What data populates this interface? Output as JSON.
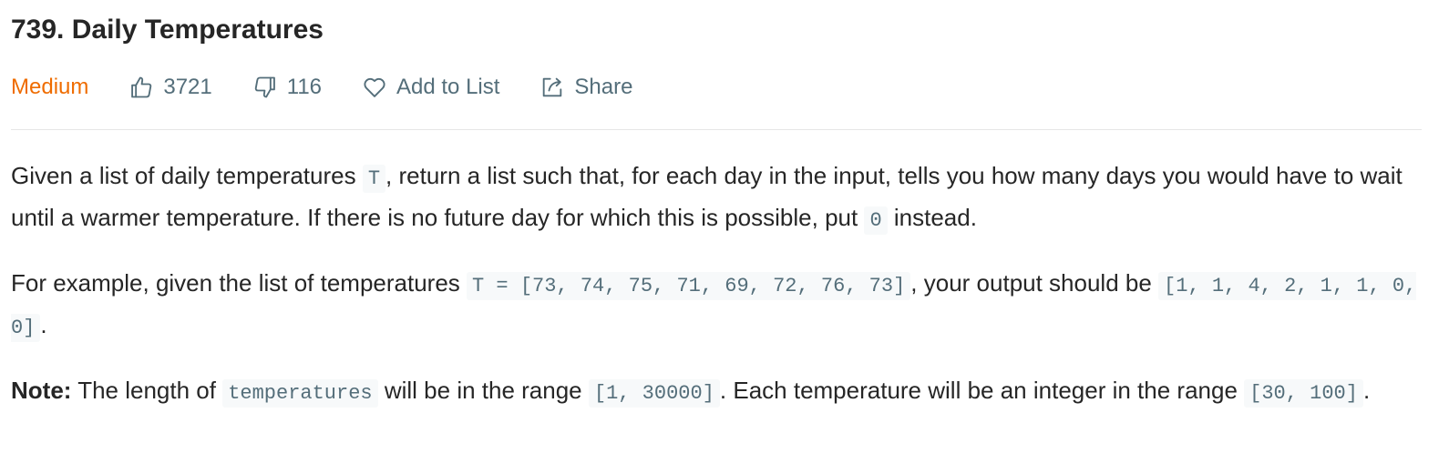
{
  "problem": {
    "title": "739. Daily Temperatures",
    "difficulty": "Medium",
    "likes": "3721",
    "dislikes": "116",
    "add_to_list_label": "Add to List",
    "share_label": "Share"
  },
  "description": {
    "p1": {
      "t1": "Given a list of daily temperatures ",
      "c1": "T",
      "t2": ", return a list such that, for each day in the input, tells you how many days you would have to wait until a warmer temperature. If there is no future day for which this is possible, put ",
      "c2": "0",
      "t3": " instead."
    },
    "p2": {
      "t1": "For example, given the list of temperatures ",
      "c1": "T = [73, 74, 75, 71, 69, 72, 76, 73]",
      "t2": ", your output should be ",
      "c2": "[1, 1, 4, 2, 1, 1, 0, 0]",
      "t3": "."
    },
    "p3": {
      "bold": "Note:",
      "t1": " The length of ",
      "c1": "temperatures",
      "t2": " will be in the range ",
      "c2": "[1, 30000]",
      "t3": ". Each temperature will be an integer in the range ",
      "c3": "[30, 100]",
      "t4": "."
    }
  },
  "colors": {
    "difficulty_medium": "#ef6c00",
    "meta_text": "#546e7a",
    "title_text": "#262626",
    "code_bg": "#f7f9fa"
  },
  "icons": {
    "likes": "thumbs-up-icon",
    "dislikes": "thumbs-down-icon",
    "add_to_list": "heart-icon",
    "share": "share-icon"
  }
}
